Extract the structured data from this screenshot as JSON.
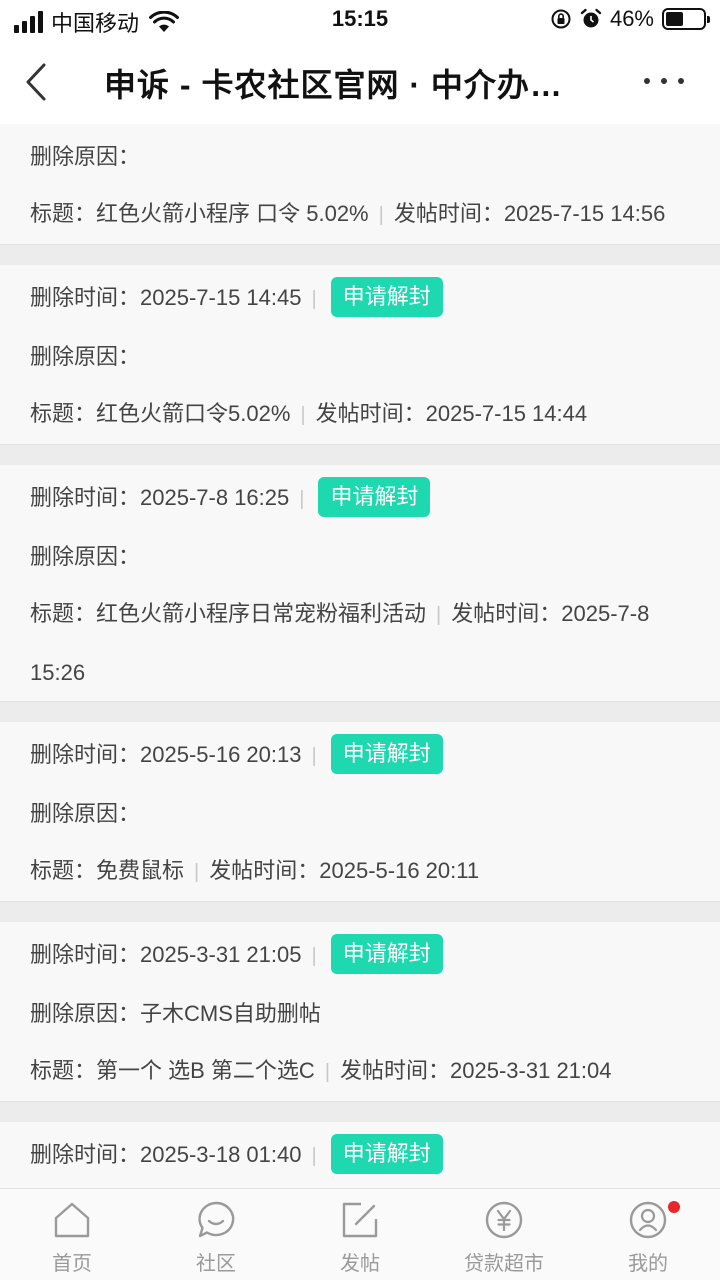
{
  "status_bar": {
    "carrier": "中国移动",
    "time": "15:15",
    "battery_percent": "46%",
    "battery_level": 0.46
  },
  "nav": {
    "title": "申诉 - 卡农社区官网 · 中介办…"
  },
  "labels": {
    "delete_time": "删除时间：",
    "delete_reason": "删除原因：",
    "title": "标题：",
    "post_time": "发帖时间：",
    "appeal": "申请解封",
    "separator": "|"
  },
  "records": [
    {
      "delete_time": "",
      "reason": "",
      "title": "红色火箭小程序 口令 5.02%",
      "post_time": "2025-7-15 14:56"
    },
    {
      "delete_time": "2025-7-15 14:45",
      "reason": "",
      "title": "红色火箭口令5.02%",
      "post_time": "2025-7-15 14:44"
    },
    {
      "delete_time": "2025-7-8 16:25",
      "reason": "",
      "title": "红色火箭小程序日常宠粉福利活动",
      "post_time": "2025-7-8 15:26"
    },
    {
      "delete_time": "2025-5-16 20:13",
      "reason": "",
      "title": "免费鼠标",
      "post_time": "2025-5-16 20:11"
    },
    {
      "delete_time": "2025-3-31 21:05",
      "reason": "子木CMS自助删帖",
      "title": "第一个 选B 第二个选C",
      "post_time": "2025-3-31 21:04"
    },
    {
      "delete_time": "2025-3-18 01:40",
      "reason": "",
      "title": "",
      "post_time": ""
    }
  ],
  "tab_bar": [
    {
      "label": "首页",
      "icon": "home-icon"
    },
    {
      "label": "社区",
      "icon": "chat-bubble-icon"
    },
    {
      "label": "发帖",
      "icon": "edit-post-icon"
    },
    {
      "label": "贷款超市",
      "icon": "yuan-coin-icon"
    },
    {
      "label": "我的",
      "icon": "profile-icon",
      "has_badge": true
    }
  ]
}
